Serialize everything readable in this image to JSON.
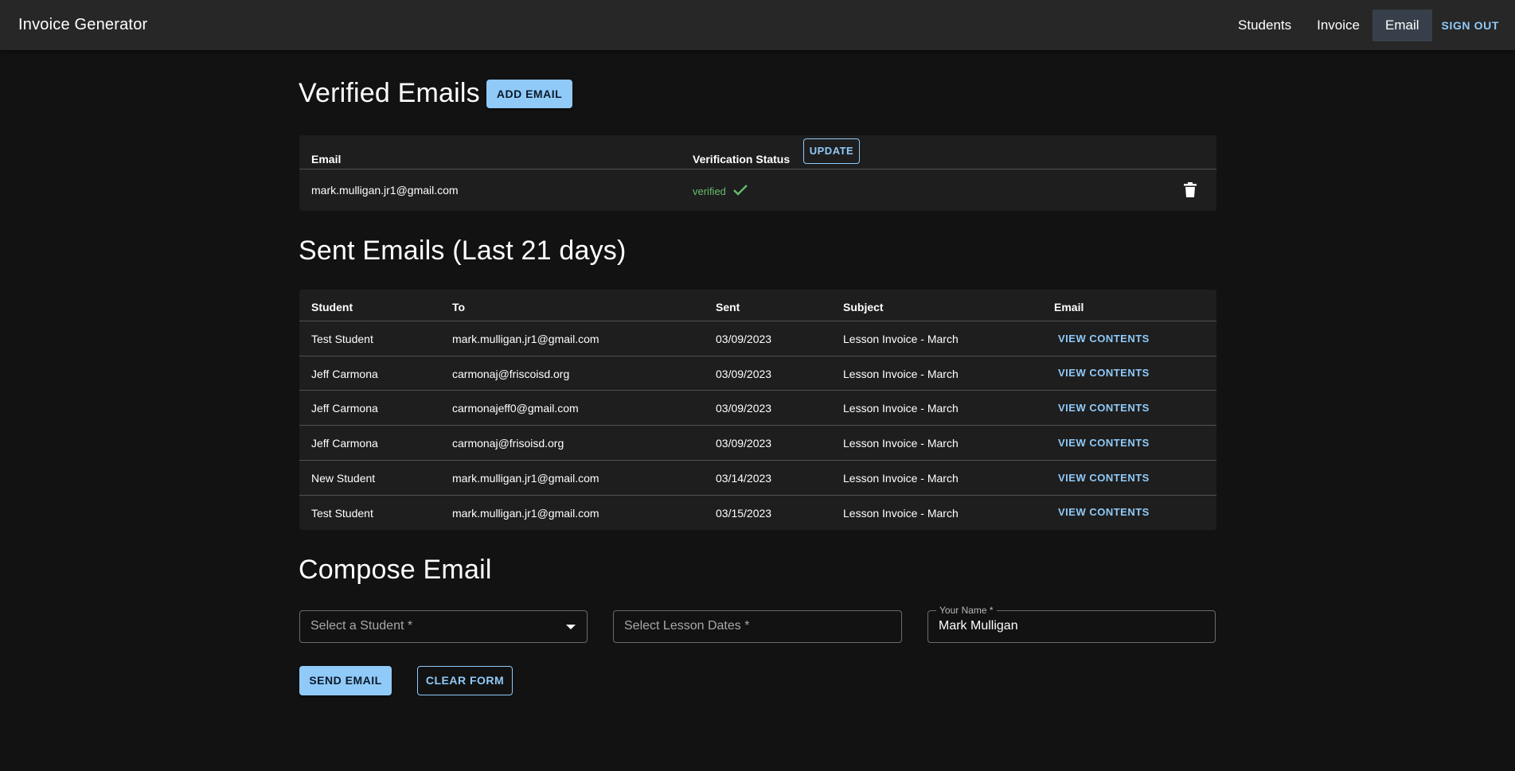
{
  "app": {
    "title": "Invoice Generator",
    "nav": {
      "students": "Students",
      "invoice": "Invoice",
      "email": "Email",
      "signout": "SIGN OUT"
    }
  },
  "verified": {
    "heading": "Verified Emails",
    "add_button": "ADD EMAIL",
    "col_email": "Email",
    "col_status": "Verification Status",
    "update_button": "UPDATE",
    "rows": [
      {
        "email": "mark.mulligan.jr1@gmail.com",
        "status": "verified"
      }
    ]
  },
  "sent": {
    "heading": "Sent Emails (Last 21 days)",
    "columns": [
      "Student",
      "To",
      "Sent",
      "Subject",
      "Email"
    ],
    "rows": [
      {
        "student": "Test Student",
        "to": "mark.mulligan.jr1@gmail.com",
        "sent": "03/09/2023",
        "subject": "Lesson Invoice - March",
        "action": "VIEW CONTENTS"
      },
      {
        "student": "Jeff Carmona",
        "to": "carmonaj@friscoisd.org",
        "sent": "03/09/2023",
        "subject": "Lesson Invoice - March",
        "action": "VIEW CONTENTS"
      },
      {
        "student": "Jeff Carmona",
        "to": "carmonajeff0@gmail.com",
        "sent": "03/09/2023",
        "subject": "Lesson Invoice - March",
        "action": "VIEW CONTENTS"
      },
      {
        "student": "Jeff Carmona",
        "to": "carmonaj@frisoisd.org",
        "sent": "03/09/2023",
        "subject": "Lesson Invoice - March",
        "action": "VIEW CONTENTS"
      },
      {
        "student": "New Student",
        "to": "mark.mulligan.jr1@gmail.com",
        "sent": "03/14/2023",
        "subject": "Lesson Invoice - March",
        "action": "VIEW CONTENTS"
      },
      {
        "student": "Test Student",
        "to": "mark.mulligan.jr1@gmail.com",
        "sent": "03/15/2023",
        "subject": "Lesson Invoice - March",
        "action": "VIEW CONTENTS"
      }
    ]
  },
  "compose": {
    "heading": "Compose Email",
    "student_placeholder": "Select a Student *",
    "dates_placeholder": "Select Lesson Dates *",
    "name_label": "Your Name *",
    "name_value": "Mark Mulligan",
    "send_button": "SEND EMAIL",
    "clear_button": "CLEAR FORM"
  },
  "colors": {
    "accent": "#90caf9",
    "verified": "#66bb6a",
    "background": "#121212",
    "surface": "#1e1e1e"
  }
}
